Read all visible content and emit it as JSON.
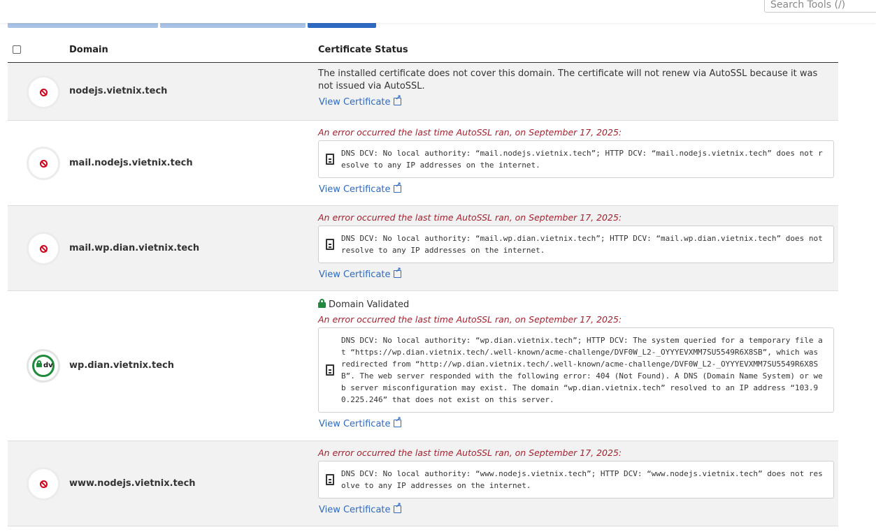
{
  "search": {
    "placeholder": "Search Tools (/)"
  },
  "table": {
    "headers": {
      "domain": "Domain",
      "status": "Certificate Status"
    },
    "rows": [
      {
        "domain": "nodejs.vietnix.tech",
        "icon": "ban-icon",
        "plain_status": "The installed certificate does not cover this domain. The certificate will not renew via AutoSSL because it was not issued via AutoSSL.",
        "link": "View Certificate"
      },
      {
        "domain": "mail.nodejs.vietnix.tech",
        "icon": "ban-icon",
        "error_title": "An error occurred the last time AutoSSL ran, on September 17, 2025:",
        "error_detail": "DNS DCV: No local authority: “mail.nodejs.vietnix.tech”; HTTP DCV: “mail.nodejs.vietnix.tech” does not resolve to any IP addresses on the internet.",
        "link": "View Certificate"
      },
      {
        "domain": "mail.wp.dian.vietnix.tech",
        "icon": "ban-icon",
        "error_title": "An error occurred the last time AutoSSL ran, on September 17, 2025:",
        "error_detail": "DNS DCV: No local authority: “mail.wp.dian.vietnix.tech”; HTTP DCV: “mail.wp.dian.vietnix.tech” does not resolve to any IP addresses on the internet.",
        "link": "View Certificate"
      },
      {
        "domain": "wp.dian.vietnix.tech",
        "icon": "dv-icon",
        "validated_label": "Domain Validated",
        "dv_badge": "dv",
        "error_title": "An error occurred the last time AutoSSL ran, on September 17, 2025:",
        "error_detail": "DNS DCV: No local authority: “wp.dian.vietnix.tech”; HTTP DCV: The system queried for a temporary file at “https://wp.dian.vietnix.tech/.well-known/acme-challenge/DVF0W_L2-_OYYYEVXMM7SU5549R6X8SB”, which was redirected from “http://wp.dian.vietnix.tech/.well-known/acme-challenge/DVF0W_L2-_OYYYEVXMM7SU5549R6X8SB”. The web server responded with the following error: 404 (Not Found). A DNS (Domain Name System) or web server misconfiguration may exist. The domain “wp.dian.vietnix.tech” resolved to an IP address “103.90.225.246” that does not exist on this server.",
        "link": "View Certificate"
      },
      {
        "domain": "www.nodejs.vietnix.tech",
        "icon": "ban-icon",
        "error_title": "An error occurred the last time AutoSSL ran, on September 17, 2025:",
        "error_detail": "DNS DCV: No local authority: “www.nodejs.vietnix.tech”; HTTP DCV: “www.nodejs.vietnix.tech” does not resolve to any IP addresses on the internet.",
        "link": "View Certificate"
      }
    ]
  },
  "colors": {
    "accent": "#2f6ac2",
    "error": "#a51f2d",
    "success": "#1f8a3b"
  }
}
